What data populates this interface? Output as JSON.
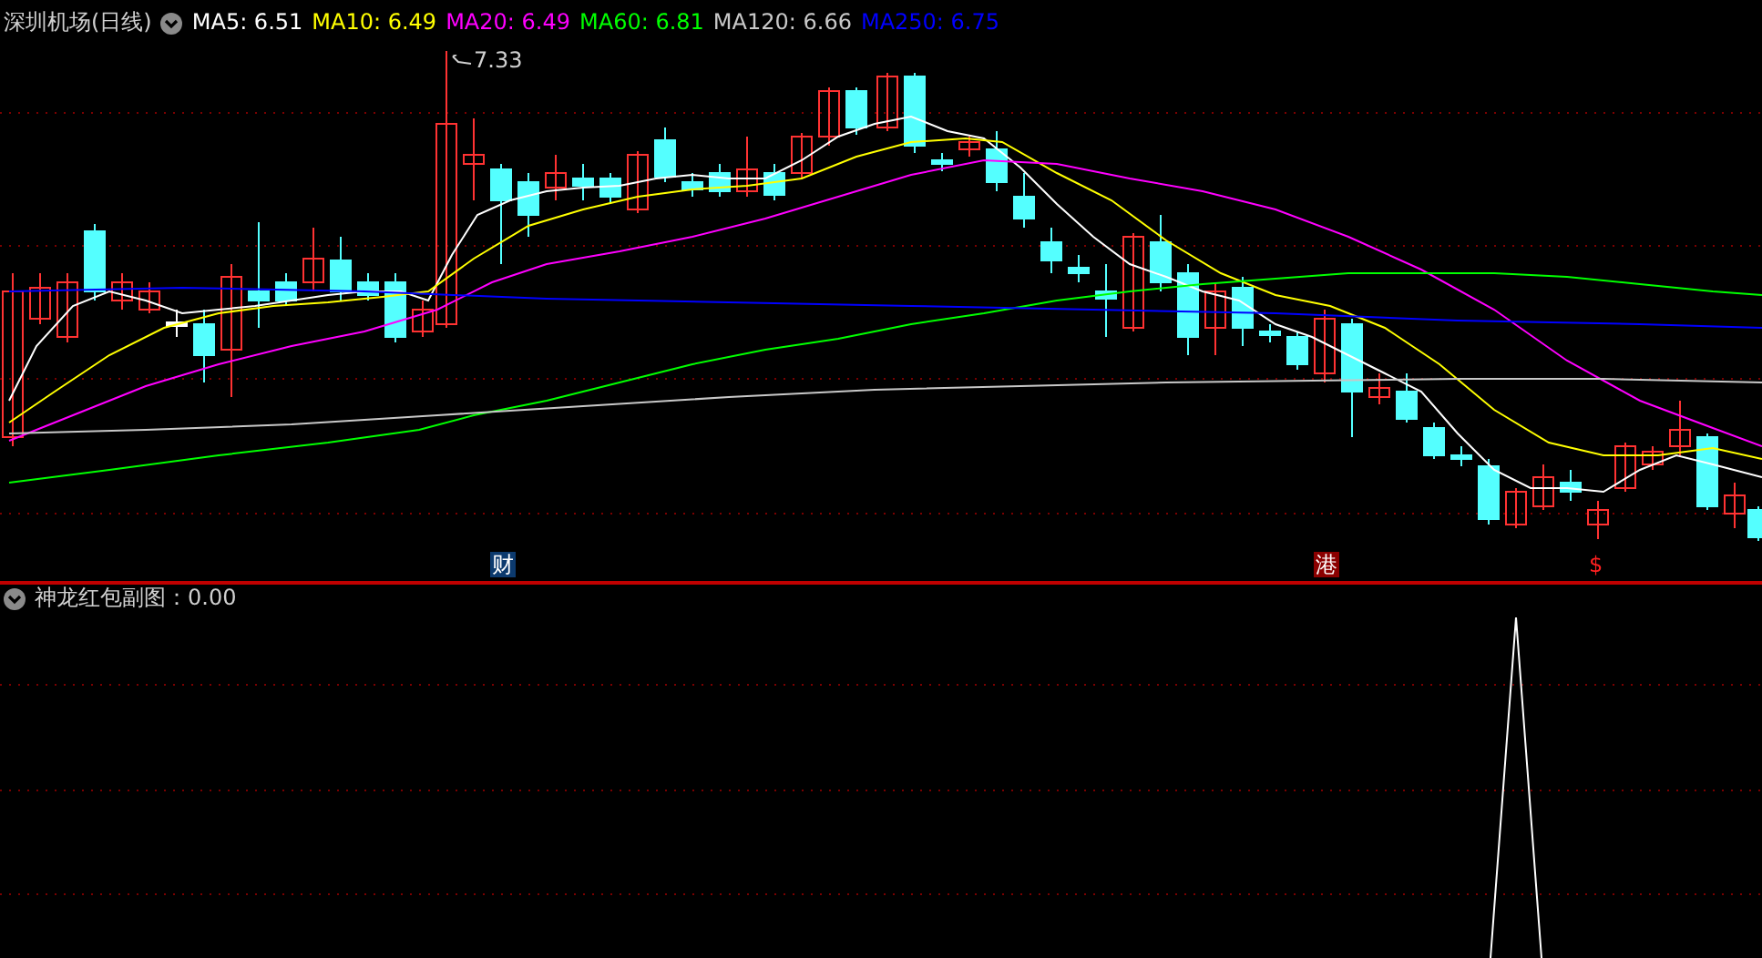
{
  "main_chart": {
    "title": "深圳机场(日线)",
    "indicator_toggle": {
      "expanded": true
    },
    "moving_averages": [
      {
        "text": "MA5: 6.51",
        "color": "#ffffff"
      },
      {
        "text": "MA10: 6.49",
        "color": "#ffff00"
      },
      {
        "text": "MA20: 6.49",
        "color": "#ff00ff"
      },
      {
        "text": "MA60: 6.81",
        "color": "#00ff00"
      },
      {
        "text": "MA120: 6.66",
        "color": "#c8c8c8"
      },
      {
        "text": "MA250: 6.75",
        "color": "#0000ff"
      }
    ],
    "high_label": "7.33",
    "event_markers": [
      {
        "text": "财",
        "kind": "boxed",
        "color": "#0c3a6e"
      },
      {
        "text": "港",
        "kind": "boxed",
        "color": "#8b0000"
      },
      {
        "text": "$",
        "kind": "plain",
        "color": "#ff2020"
      }
    ]
  },
  "sub_chart": {
    "title": "神龙红包副图：0.00",
    "indicator_toggle": {
      "expanded": true
    }
  }
}
